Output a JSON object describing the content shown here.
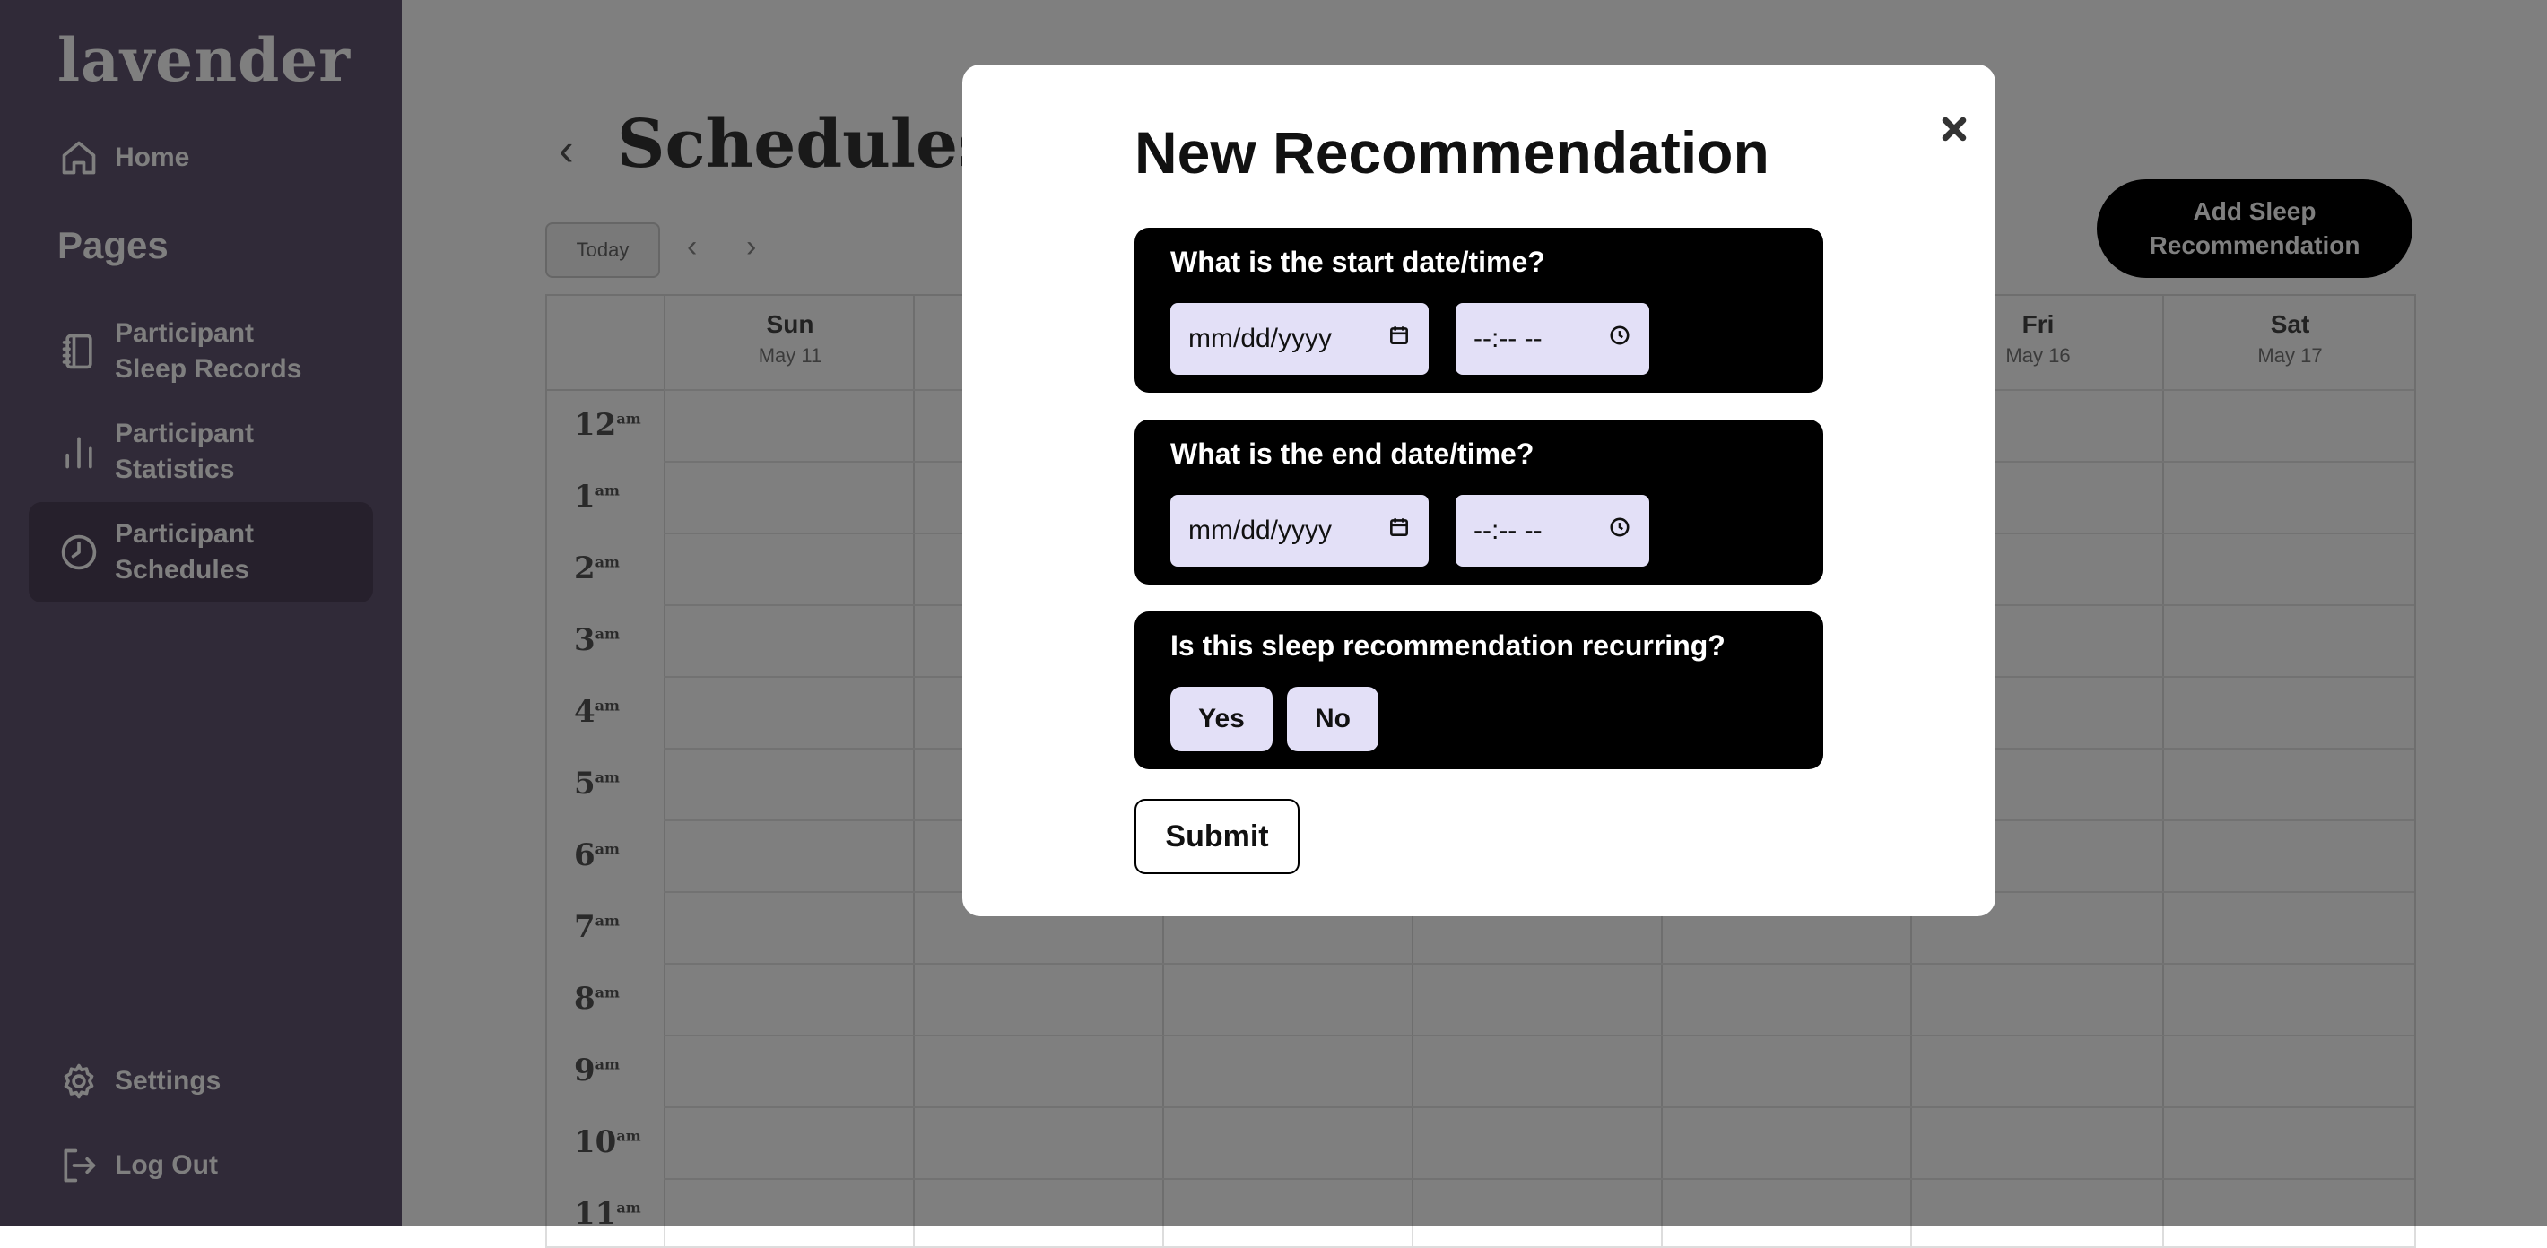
{
  "sidebar": {
    "logo": "lavender",
    "home_label": "Home",
    "pages_heading": "Pages",
    "items": [
      {
        "label": "Participant\nSleep Records",
        "icon": "notebook-icon"
      },
      {
        "label": "Participant\nStatistics",
        "icon": "bar-chart-icon"
      },
      {
        "label": "Participant\nSchedules",
        "icon": "clock-icon",
        "active": true
      }
    ],
    "settings_label": "Settings",
    "logout_label": "Log Out"
  },
  "main": {
    "title": "Schedules fo",
    "today_label": "Today",
    "prev_label": "‹",
    "next_label": "›",
    "add_button": "Add Sleep\nRecommendation",
    "days": [
      {
        "name": "Sun",
        "date": "May 11"
      },
      {
        "name": "",
        "date": ""
      },
      {
        "name": "",
        "date": ""
      },
      {
        "name": "",
        "date": ""
      },
      {
        "name": "",
        "date": ""
      },
      {
        "name": "Fri",
        "date": "May 16"
      },
      {
        "name": "Sat",
        "date": "May 17"
      }
    ],
    "hours": [
      "12",
      "1",
      "2",
      "3",
      "4",
      "5",
      "6",
      "7",
      "8",
      "9",
      "10",
      "11"
    ],
    "hour_suffix": "am"
  },
  "modal": {
    "title": "New Recommendation",
    "close_icon": "close-icon",
    "start": {
      "question": "What is the start date/time?",
      "date_placeholder": "mm/dd/yyyy",
      "time_placeholder": "--:-- --"
    },
    "end": {
      "question": "What is the end date/time?",
      "date_placeholder": "mm/dd/yyyy",
      "time_placeholder": "--:-- --"
    },
    "recurring": {
      "question": "Is this sleep recommendation recurring?",
      "yes_label": "Yes",
      "no_label": "No"
    },
    "submit_label": "Submit"
  },
  "colors": {
    "sidebar_bg": "#615470",
    "sidebar_active": "#4d4059",
    "field_bg": "#e3e0f7",
    "card_bg": "#000000"
  }
}
